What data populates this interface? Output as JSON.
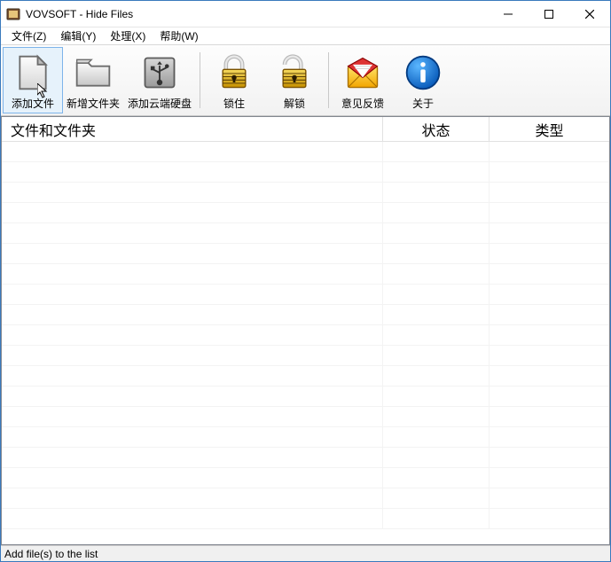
{
  "title": "VOVSOFT - Hide Files",
  "menus": {
    "file": "文件(Z)",
    "edit": "编辑(Y)",
    "process": "处理(X)",
    "help": "帮助(W)"
  },
  "toolbar": {
    "add_file": "添加文件",
    "new_folder": "新增文件夹",
    "add_cloud": "添加云端硬盘",
    "lock": "锁住",
    "unlock": "解锁",
    "feedback": "意见反馈",
    "about": "关于"
  },
  "columns": {
    "files": "文件和文件夹",
    "status": "状态",
    "type": "类型"
  },
  "rows": [],
  "statusbar": "Add file(s) to the list"
}
